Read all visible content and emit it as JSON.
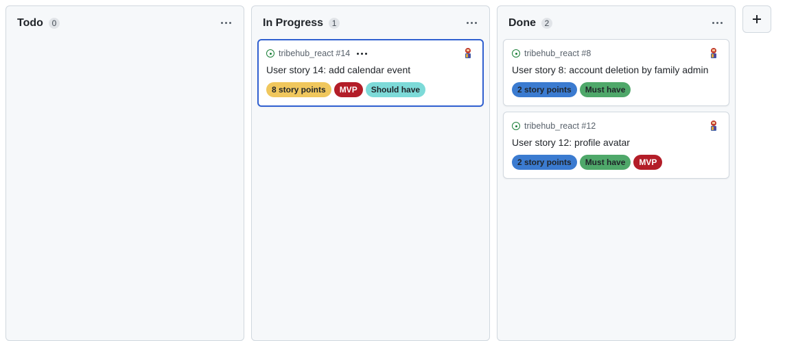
{
  "columns": [
    {
      "title": "Todo",
      "count": "0",
      "cards": []
    },
    {
      "title": "In Progress",
      "count": "1",
      "cards": [
        {
          "repo_ref": "tribehub_react #14",
          "title": "User story 14: add calendar event",
          "selected": true,
          "labels": [
            {
              "text": "8 story points",
              "color": "#f0c75d"
            },
            {
              "text": "MVP",
              "color": "#b31d28"
            },
            {
              "text": "Should have",
              "color": "#7ddad8"
            }
          ]
        }
      ]
    },
    {
      "title": "Done",
      "count": "2",
      "cards": [
        {
          "repo_ref": "tribehub_react #8",
          "title": "User story 8: account deletion by family admin",
          "labels": [
            {
              "text": "2 story points",
              "color": "#3b7bd0"
            },
            {
              "text": "Must have",
              "color": "#4fa86a"
            }
          ]
        },
        {
          "repo_ref": "tribehub_react #12",
          "title": "User story 12: profile avatar",
          "labels": [
            {
              "text": "2 story points",
              "color": "#3b7bd0"
            },
            {
              "text": "Must have",
              "color": "#4fa86a"
            },
            {
              "text": "MVP",
              "color": "#b31d28"
            }
          ]
        }
      ]
    }
  ],
  "icons": {
    "column_menu": "kebab-horizontal-icon",
    "card_menu": "kebab-horizontal-icon",
    "issue_status": "issue-open-icon",
    "assignee": "avatar",
    "add_column": "plus-icon"
  },
  "colors": {
    "open_issue": "#1a7f37",
    "selected_border": "#2f5fd0"
  }
}
